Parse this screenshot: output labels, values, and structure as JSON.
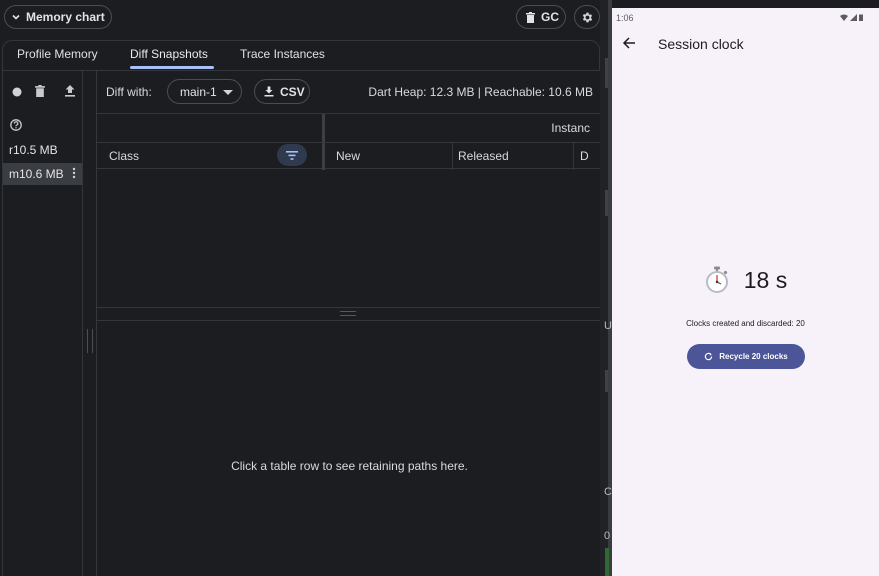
{
  "devtools": {
    "memory_chart_label": "Memory chart",
    "gc_label": "GC",
    "tabs": [
      "Profile Memory",
      "Diff Snapshots",
      "Trace Instances"
    ],
    "active_tab": "Diff Snapshots",
    "snapshots": [
      {
        "label": "r10.5 MB"
      },
      {
        "label": "m10.6 MB",
        "selected": true
      }
    ],
    "toolbar": {
      "diff_with_label": "Diff with:",
      "diff_with_value": "main-1",
      "csv_label": "CSV",
      "heap_info": "Dart Heap: 12.3 MB | Reachable: 10.6 MB"
    },
    "table": {
      "group_header": "Instanc",
      "columns": [
        "Class",
        "New",
        "Released",
        "D"
      ]
    },
    "retaining_message": "Click a table row to see retaining paths here."
  },
  "strip": {
    "letters": [
      "U",
      "C",
      "0"
    ]
  },
  "phone": {
    "status_time": "1:06",
    "title": "Session clock",
    "clock_value": "18 s",
    "clocks_text": "Clocks created and discarded: 20",
    "recycle_label": "Recycle 20 clocks"
  },
  "icons": {
    "chevron": "chevron-down-icon",
    "trash": "trash-icon",
    "settings": "gear-icon",
    "record": "record-icon",
    "export": "upload-icon",
    "help": "help-icon",
    "more": "more-vert-icon",
    "download": "download-icon",
    "filter": "filter-icon",
    "back": "arrow-back-icon",
    "stopwatch": "stopwatch-icon",
    "refresh": "refresh-icon"
  },
  "colors": {
    "accent_tab": "#a9c1f8",
    "button_primary": "#4b5598",
    "phone_bg": "#f7f2fa",
    "devtools_bg": "#1b1d21"
  }
}
